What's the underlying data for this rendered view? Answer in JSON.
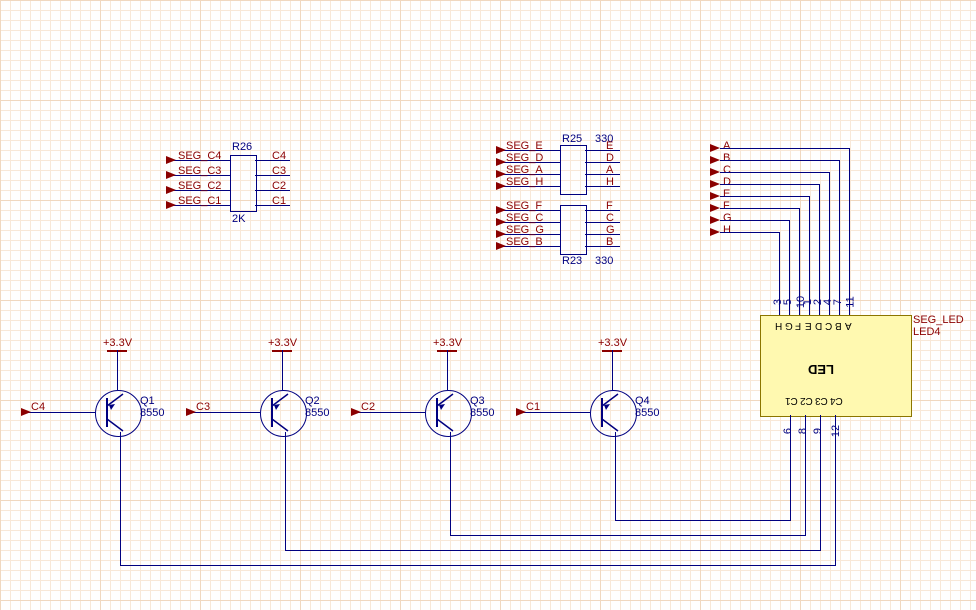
{
  "resistor_network_left": {
    "ref": "R26",
    "value": "2K",
    "left": [
      "SEG_C4",
      "SEG_C3",
      "SEG_C2",
      "SEG_C1"
    ],
    "right": [
      "C4",
      "C3",
      "C2",
      "C1"
    ]
  },
  "resistor_network_right": {
    "refs": [
      "R25",
      "R23"
    ],
    "value": "330",
    "left": [
      "SEG_E",
      "SEG_D",
      "SEG_A",
      "SEG_H",
      "SEG_F",
      "SEG_C",
      "SEG_G",
      "SEG_B"
    ],
    "right": [
      "E",
      "D",
      "A",
      "H",
      "F",
      "C",
      "G",
      "B"
    ]
  },
  "seg_inputs": [
    "A",
    "B",
    "C",
    "D",
    "E",
    "F",
    "G",
    "H"
  ],
  "led": {
    "ref": "SEG_LED",
    "designator": "LED4",
    "text": "LED",
    "top_pins": [
      "3",
      "5",
      "10",
      "1",
      "2",
      "4",
      "7",
      "11"
    ],
    "top_labels": [
      "H",
      "G",
      "F",
      "E",
      "D",
      "C",
      "B",
      "A"
    ],
    "bottom_pins": [
      "6",
      "8",
      "9",
      "12"
    ],
    "bottom_labels": [
      "C1",
      "C2",
      "C3",
      "C4"
    ]
  },
  "transistors": [
    {
      "ref": "Q1",
      "value": "8550",
      "base": "C4",
      "supply": "+3.3V"
    },
    {
      "ref": "Q2",
      "value": "8550",
      "base": "C3",
      "supply": "+3.3V"
    },
    {
      "ref": "Q3",
      "value": "8550",
      "base": "C2",
      "supply": "+3.3V"
    },
    {
      "ref": "Q4",
      "value": "8550",
      "base": "C1",
      "supply": "+3.3V"
    }
  ]
}
